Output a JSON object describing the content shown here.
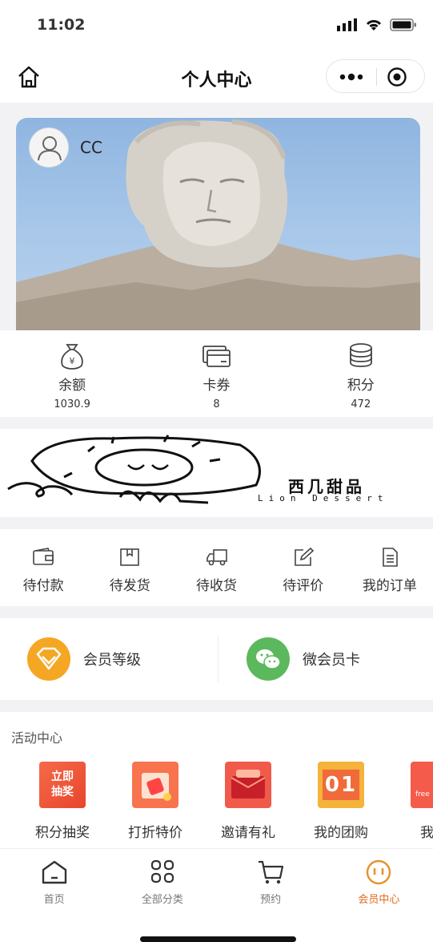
{
  "status_bar": {
    "time": "11:02"
  },
  "nav": {
    "title": "个人中心",
    "home_icon": "home-icon",
    "more_icon": "more-dots-icon",
    "close_icon": "target-close-icon"
  },
  "profile": {
    "username": "CC",
    "avatar_icon": "user-avatar-icon"
  },
  "assets": [
    {
      "label": "余额",
      "value": "1030.9",
      "icon": "money-bag-icon"
    },
    {
      "label": "卡券",
      "value": "8",
      "icon": "card-icon"
    },
    {
      "label": "积分",
      "value": "472",
      "icon": "coins-icon"
    }
  ],
  "banner": {
    "brand_cn": "西几甜品",
    "brand_en": "Lion Dessert"
  },
  "orders": [
    {
      "label": "待付款",
      "icon": "wallet-icon"
    },
    {
      "label": "待发货",
      "icon": "box-icon"
    },
    {
      "label": "待收货",
      "icon": "truck-icon"
    },
    {
      "label": "待评价",
      "icon": "edit-icon"
    },
    {
      "label": "我的订单",
      "icon": "document-icon"
    }
  ],
  "members": [
    {
      "label": "会员等级",
      "icon": "diamond-icon",
      "color": "#f5a623"
    },
    {
      "label": "微会员卡",
      "icon": "wechat-icon",
      "color": "#5cb85c"
    }
  ],
  "activity": {
    "title": "活动中心",
    "items": [
      {
        "label": "积分抽奖",
        "pic_text": "立即抽奖"
      },
      {
        "label": "打折特价",
        "pic_text": ""
      },
      {
        "label": "邀请有礼",
        "pic_text": ""
      },
      {
        "label": "我的团购",
        "pic_text": "01"
      },
      {
        "label": "我的",
        "pic_text": "free"
      }
    ]
  },
  "tabbar": [
    {
      "label": "首页",
      "icon": "home-icon",
      "active": false
    },
    {
      "label": "全部分类",
      "icon": "grid-icon",
      "active": false
    },
    {
      "label": "预约",
      "icon": "cart-icon",
      "active": false
    },
    {
      "label": "会员中心",
      "icon": "member-face-icon",
      "active": true
    }
  ],
  "colors": {
    "accent": "#e06a1b",
    "bg": "#f2f2f5"
  }
}
